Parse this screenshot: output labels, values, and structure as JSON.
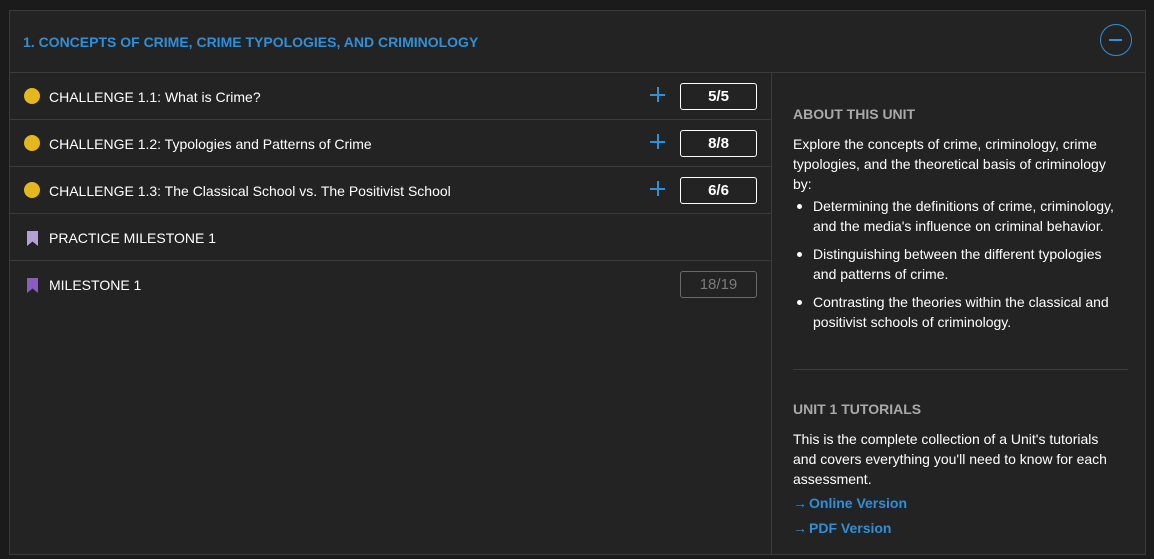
{
  "unit": {
    "title": "1. CONCEPTS OF CRIME, CRIME TYPOLOGIES, AND CRIMINOLOGY",
    "collapse_icon": "minus-circle-icon"
  },
  "rows": [
    {
      "label": "CHALLENGE 1.1: What is Crime?",
      "score": "5/5",
      "icon": "status-dot-icon"
    },
    {
      "label": "CHALLENGE 1.2: Typologies and Patterns of Crime",
      "score": "8/8",
      "icon": "status-dot-icon"
    },
    {
      "label": "CHALLENGE 1.3: The Classical School vs. The Positivist School",
      "score": "6/6",
      "icon": "status-dot-icon"
    },
    {
      "label": "PRACTICE MILESTONE 1",
      "icon": "bookmark-icon"
    },
    {
      "label": "MILESTONE 1",
      "score": "18/19",
      "icon": "bookmark-icon"
    }
  ],
  "about": {
    "title": "ABOUT THIS UNIT",
    "intro": "Explore the concepts of crime, criminology, crime typologies, and the theoretical basis of criminology by:",
    "bullets": [
      "Determining the definitions of crime, criminology, and the media's influence on criminal behavior.",
      "Distinguishing between the different typologies and patterns of crime.",
      "Contrasting the theories within the classical and positivist schools of criminology."
    ]
  },
  "tutorials": {
    "title": "UNIT 1 TUTORIALS",
    "text": "This is the complete collection of a Unit's tutorials and covers everything you'll need to know for each assessment.",
    "links": [
      "Online Version",
      "PDF Version"
    ]
  },
  "colors": {
    "accent": "#2f8fd8",
    "status_dot": "#e4b81c",
    "practice_bookmark": "#b49fd6",
    "milestone_bookmark": "#8a5cc2"
  }
}
